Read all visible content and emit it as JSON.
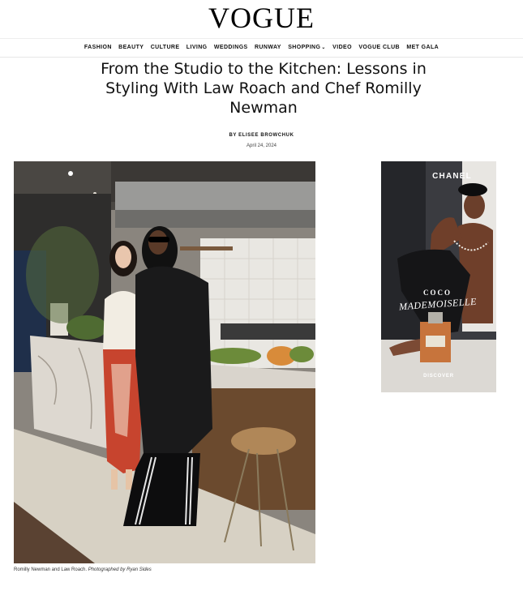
{
  "masthead": {
    "logo": "VOGUE"
  },
  "nav": {
    "items": [
      "FASHION",
      "BEAUTY",
      "CULTURE",
      "LIVING",
      "WEDDINGS",
      "RUNWAY",
      "SHOPPING",
      "VIDEO",
      "VOGUE CLUB",
      "MET GALA"
    ],
    "shopping_has_dropdown": true
  },
  "article": {
    "title": "From the Studio to the Kitchen: Lessons in Styling With Law Roach and Chef Romilly Newman",
    "byline": "BY ELISEE BROWCHUK",
    "date": "April 24, 2024",
    "caption_text": "Romilly Newman and Law Roach. ",
    "caption_credit": "Photographed by Ryan Sides"
  },
  "ad": {
    "brand": "CHANEL",
    "tagline_top": "COCO",
    "tagline_bottom": "MADEMOISELLE",
    "cta": "DISCOVER"
  }
}
